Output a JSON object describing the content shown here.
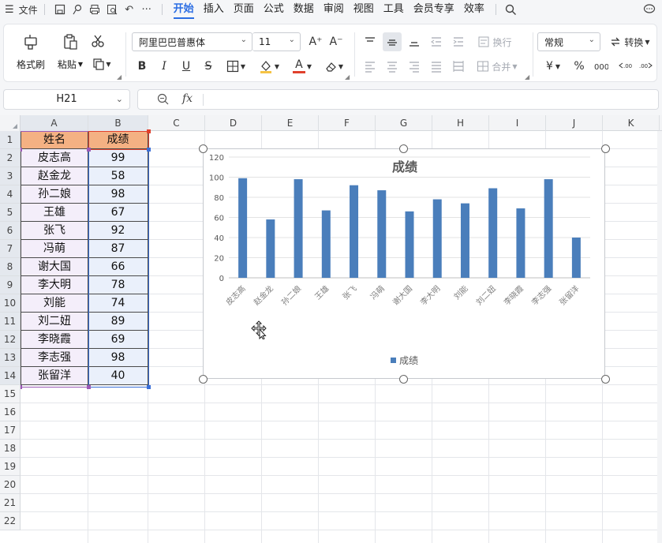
{
  "menu": {
    "file_label": "文件",
    "more_label": "···",
    "tabs": [
      "开始",
      "插入",
      "页面",
      "公式",
      "数据",
      "审阅",
      "视图",
      "工具",
      "会员专享",
      "效率"
    ],
    "active_tab": "开始"
  },
  "ribbon": {
    "format_painter": "格式刷",
    "paste": "粘贴",
    "font_name": "阿里巴巴普惠体",
    "font_size": "11",
    "wrap_text": "换行",
    "merge": "合并",
    "number_format": "常规",
    "convert": "转换",
    "bold": "B",
    "italic": "I",
    "underline": "U",
    "strike": "S",
    "font_color_glyph": "A",
    "percent": "%",
    "grow": "A⁺",
    "shrink": "A⁻",
    "accent_color": "#2b6de3",
    "fill_highlight": "#f6c344",
    "font_color": "#e0402c"
  },
  "formula_bar": {
    "cell_ref": "H21",
    "fx_label": "fx",
    "formula": ""
  },
  "sheet": {
    "columns": [
      "A",
      "B",
      "C",
      "D",
      "E",
      "F",
      "G",
      "H",
      "I",
      "J",
      "K"
    ],
    "rows": [
      "1",
      "2",
      "3",
      "4",
      "5",
      "6",
      "7",
      "8",
      "9",
      "10",
      "11",
      "12",
      "13",
      "14",
      "15",
      "16",
      "17",
      "18",
      "19",
      "20",
      "21",
      "22"
    ],
    "header_name": "姓名",
    "header_score": "成绩",
    "records": [
      {
        "name": "皮志高",
        "score": "99"
      },
      {
        "name": "赵金龙",
        "score": "58"
      },
      {
        "name": "孙二娘",
        "score": "98"
      },
      {
        "name": "王雄",
        "score": "67"
      },
      {
        "name": "张飞",
        "score": "92"
      },
      {
        "name": "冯萌",
        "score": "87"
      },
      {
        "name": "谢大国",
        "score": "66"
      },
      {
        "name": "李大明",
        "score": "78"
      },
      {
        "name": "刘能",
        "score": "74"
      },
      {
        "name": "刘二妞",
        "score": "89"
      },
      {
        "name": "李晓霞",
        "score": "69"
      },
      {
        "name": "李志强",
        "score": "98"
      },
      {
        "name": "张留洋",
        "score": "40"
      }
    ],
    "header_fill": "#f4b183",
    "name_fill": "#f4eefa",
    "score_fill": "#eaf0fb"
  },
  "chart_data": {
    "type": "bar",
    "title": "成绩",
    "categories": [
      "皮志高",
      "赵金龙",
      "孙二娘",
      "王雄",
      "张飞",
      "冯萌",
      "谢大国",
      "李大明",
      "刘能",
      "刘二妞",
      "李晓霞",
      "李志强",
      "张留洋"
    ],
    "series": [
      {
        "name": "成绩",
        "values": [
          99,
          58,
          98,
          67,
          92,
          87,
          66,
          78,
          74,
          89,
          69,
          98,
          40
        ],
        "color": "#4a7ebb"
      }
    ],
    "yticks": [
      "0",
      "20",
      "40",
      "60",
      "80",
      "100",
      "120"
    ],
    "ylim": [
      0,
      120
    ],
    "grid": true,
    "legend": "bottom"
  }
}
